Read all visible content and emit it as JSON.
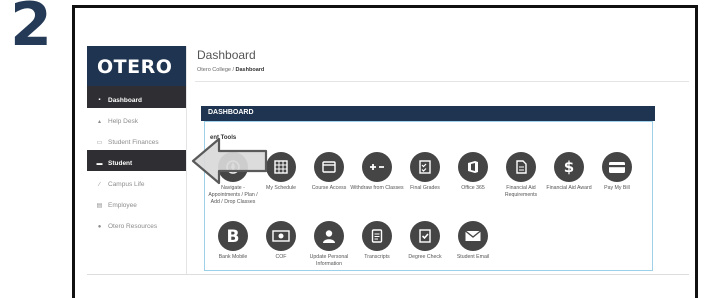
{
  "step_number": "2",
  "sidebar": {
    "logo": "OTERO",
    "items": [
      {
        "label": "Dashboard",
        "icon": "grid-icon",
        "glyph": "▪"
      },
      {
        "label": "Help Desk",
        "icon": "person-icon",
        "glyph": "▴"
      },
      {
        "label": "Student Finances",
        "icon": "card-icon",
        "glyph": "▭"
      },
      {
        "label": "Student",
        "icon": "graduation-cap-icon",
        "glyph": "▬"
      },
      {
        "label": "Campus Life",
        "icon": "pencil-icon",
        "glyph": "∕"
      },
      {
        "label": "Employee",
        "icon": "building-icon",
        "glyph": "▤"
      },
      {
        "label": "Otero Resources",
        "icon": "info-icon",
        "glyph": "●"
      }
    ]
  },
  "header": {
    "title": "Dashboard",
    "breadcrumb": {
      "root": "Otero College",
      "separator": "/",
      "current": "Dashboard"
    }
  },
  "dashboard_heading": "DASHBOARD",
  "tools_heading": "ent Tools",
  "tools": [
    {
      "label": "Navigate - Appointments / Plan / Add / Drop Classes",
      "icon": "compass-icon"
    },
    {
      "label": "My Schedule",
      "icon": "calendar-grid-icon"
    },
    {
      "label": "Course Access",
      "icon": "browser-window-icon"
    },
    {
      "label": "Withdraw from Classes",
      "icon": "plus-minus-icon"
    },
    {
      "label": "Final Grades",
      "icon": "checklist-icon"
    },
    {
      "label": "Office 365",
      "icon": "office-icon"
    },
    {
      "label": "Financial Aid Requirements",
      "icon": "document-icon"
    },
    {
      "label": "Financial Aid Award",
      "icon": "dollar-icon"
    },
    {
      "label": "Pay My Bill",
      "icon": "credit-card-icon"
    },
    {
      "label": "Bank Mobile",
      "icon": "bankmobile-logo-icon"
    },
    {
      "label": "COF",
      "icon": "cash-icon"
    },
    {
      "label": "Update Personal Information",
      "icon": "user-icon"
    },
    {
      "label": "Transcripts",
      "icon": "transcript-icon"
    },
    {
      "label": "Degree Check",
      "icon": "degree-check-icon"
    },
    {
      "label": "Student Email",
      "icon": "envelope-icon"
    }
  ],
  "colors": {
    "brand_navy": "#1f3450",
    "step_number": "#243a57",
    "active_nav": "#2f2f33",
    "icon_circle": "#454545",
    "panel_border": "#9fd0ea",
    "arrow_fill": "#d9d9d9",
    "arrow_stroke": "#5a5a5a"
  }
}
